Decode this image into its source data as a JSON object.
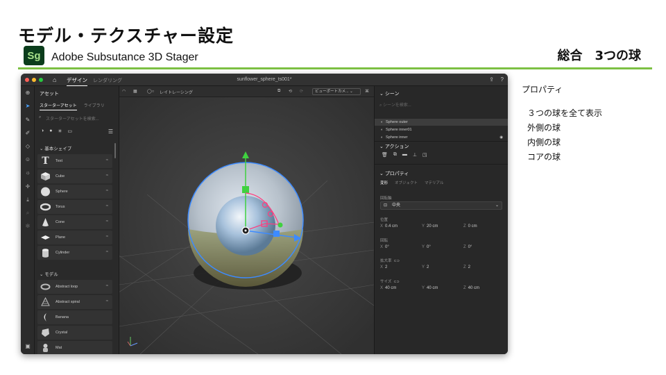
{
  "slide": {
    "title": "モデル・テクスチャー設定",
    "logo_text": "Sg",
    "app_name": "Adobe Subsutance 3D Stager",
    "section": "総合　3つの球"
  },
  "notes": {
    "heading": "プロパティ",
    "items": [
      "３つの球を全て表示",
      "外側の球",
      "内側の球",
      "コアの球"
    ]
  },
  "app": {
    "window_colors": [
      "#ff5f57",
      "#febc2e",
      "#28c840"
    ],
    "tabs": {
      "design": "デザイン",
      "render": "レンダリング"
    },
    "document_title": "sunflower_sphere_ts001*",
    "assets": {
      "header": "アセット",
      "subtab_starter": "スターターアセット",
      "subtab_library": "ライブラリ",
      "search_placeholder": "スターターアセットを検索...",
      "basic_shapes_header": "基本シェイプ",
      "basic_shapes": [
        "Text",
        "Cube",
        "Sphere",
        "Torus",
        "Cone",
        "Plane",
        "Cylinder"
      ],
      "models_header": "モデル",
      "models": [
        "Abstract loop",
        "Abstract spiral",
        "Banana",
        "Crystal",
        "Mat"
      ]
    },
    "viewport": {
      "raytracing": "レイトレーシング",
      "camera_select": "ビューポートカメ..."
    },
    "scene": {
      "header": "シーン",
      "search_placeholder": "シーンを検索...",
      "layers": [
        "Sphere outer",
        "Sphere inner01",
        "Sphere inner"
      ],
      "actions_header": "アクション",
      "properties_header": "プロパティ",
      "prop_tabs": [
        "変形",
        "オブジェクト",
        "マテリアル"
      ],
      "pivot_label": "回転軸",
      "pivot_value": "中央",
      "position_label": "位置",
      "position": {
        "x": "0.4 cm",
        "y": "20 cm",
        "z": "0 cm"
      },
      "rotation_label": "回転",
      "rotation": {
        "x": "0°",
        "y": "0°",
        "z": "0°"
      },
      "scale_label": "拡大率",
      "scale": {
        "x": "2",
        "y": "2",
        "z": "2"
      },
      "size_label": "サイズ",
      "size": {
        "x": "40 cm",
        "y": "40 cm",
        "z": "40 cm"
      }
    }
  }
}
